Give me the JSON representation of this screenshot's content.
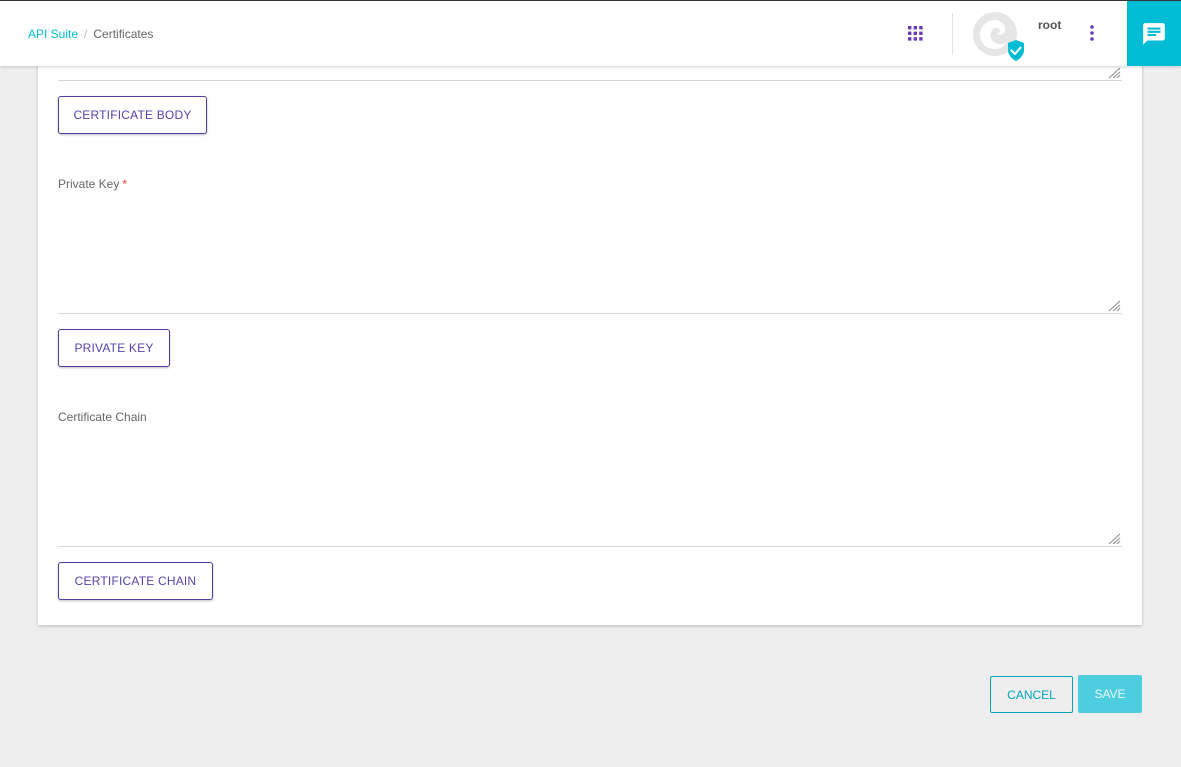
{
  "breadcrumb": {
    "parent": "API Suite",
    "separator": "/",
    "current": "Certificates"
  },
  "user": {
    "name": "root"
  },
  "icons": {
    "apps": "apps-grid-icon",
    "avatar": "user-avatar",
    "verified": "verified-shield-icon",
    "more": "more-vert-icon",
    "chat": "chat-icon"
  },
  "form": {
    "certificate_body": {
      "button_label": "CERTIFICATE BODY"
    },
    "private_key": {
      "label": "Private Key",
      "required_mark": "*",
      "button_label": "PRIVATE KEY"
    },
    "certificate_chain": {
      "label": "Certificate Chain",
      "button_label": "CERTIFICATE CHAIN"
    }
  },
  "actions": {
    "cancel_label": "CANCEL",
    "save_label": "SAVE"
  },
  "colors": {
    "accent": "#00bcd4",
    "primary_button": "#5146a8",
    "apps_icon": "#6a3db8",
    "save_disabled": "#4fcde0"
  }
}
